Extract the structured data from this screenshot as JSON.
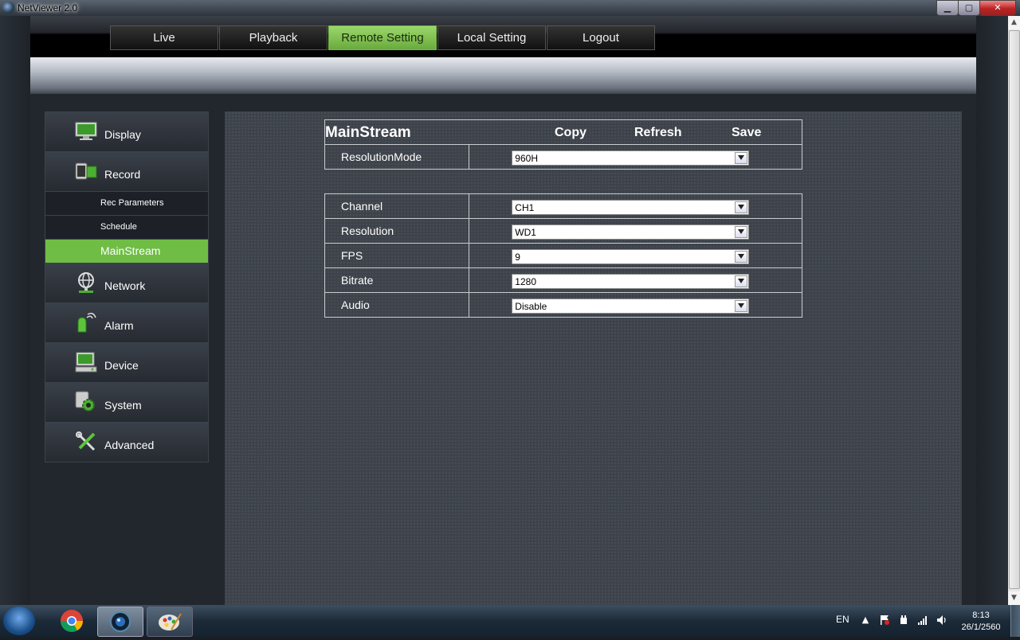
{
  "window": {
    "title": "NetViewer 2.0",
    "controls": {
      "minimize": "▁",
      "maximize": "▢",
      "close": "✕"
    }
  },
  "nav": {
    "tabs": [
      {
        "label": "Live",
        "active": false
      },
      {
        "label": "Playback",
        "active": false
      },
      {
        "label": "Remote Setting",
        "active": true
      },
      {
        "label": "Local Setting",
        "active": false
      },
      {
        "label": "Logout",
        "active": false
      }
    ]
  },
  "sidebar": {
    "items": [
      {
        "label": "Display",
        "icon": "monitor-icon"
      },
      {
        "label": "Record",
        "icon": "record-icon"
      },
      {
        "label": "Network",
        "icon": "network-icon"
      },
      {
        "label": "Alarm",
        "icon": "alarm-icon"
      },
      {
        "label": "Device",
        "icon": "device-icon"
      },
      {
        "label": "System",
        "icon": "system-gear-icon"
      },
      {
        "label": "Advanced",
        "icon": "tools-icon"
      }
    ],
    "record_sub": [
      {
        "label": "Rec Parameters",
        "active": false
      },
      {
        "label": "Schedule",
        "active": false
      },
      {
        "label": "MainStream",
        "active": true
      }
    ]
  },
  "main": {
    "title": "MainStream",
    "actions": {
      "copy": "Copy",
      "refresh": "Refresh",
      "save": "Save"
    },
    "resolution_mode": {
      "label": "ResolutionMode",
      "value": "960H"
    },
    "fields": [
      {
        "label": "Channel",
        "value": "CH1"
      },
      {
        "label": "Resolution",
        "value": "WD1"
      },
      {
        "label": "FPS",
        "value": "9"
      },
      {
        "label": "Bitrate",
        "value": "1280"
      },
      {
        "label": "Audio",
        "value": "Disable"
      }
    ]
  },
  "taskbar": {
    "lang": "EN",
    "tray_up": "▲",
    "time": "8:13",
    "date": "26/1/2560"
  },
  "colors": {
    "accent_green": "#6fbd45",
    "panel_bg": "#3e434b",
    "taskbar": "#1c2a38"
  }
}
